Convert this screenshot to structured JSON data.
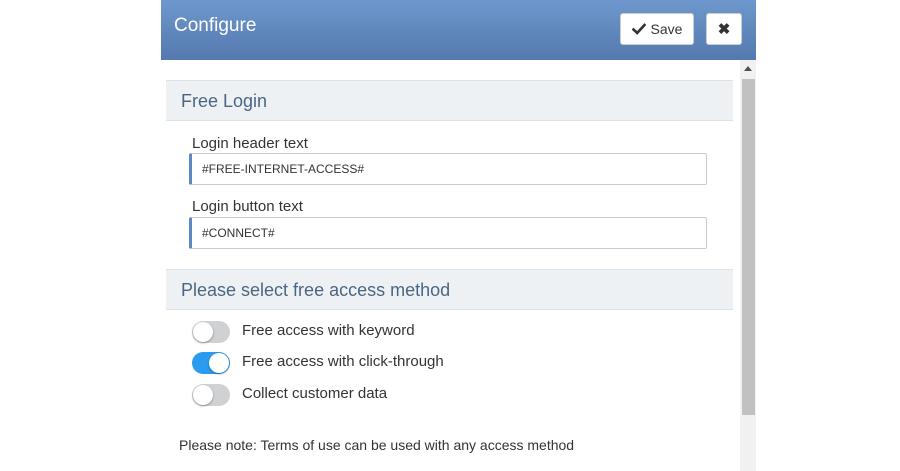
{
  "header": {
    "title": "Configure",
    "save_label": "Save",
    "save_icon": "check-icon",
    "close_icon": "close-icon",
    "close_glyph": "✖",
    "background_color": "#5f87bf"
  },
  "free_login": {
    "title": "Free Login",
    "header_text": {
      "label": "Login header text",
      "value": "#FREE-INTERNET-ACCESS#"
    },
    "button_text": {
      "label": "Login button text",
      "value": "#CONNECT#"
    }
  },
  "access_method": {
    "title": "Please select free access method",
    "options": [
      {
        "label": "Free access with keyword",
        "enabled": false
      },
      {
        "label": "Free access with click-through",
        "enabled": true
      },
      {
        "label": "Collect customer data",
        "enabled": false
      }
    ],
    "toggle_on_color": "#2b9bf0"
  },
  "note": "Please note: Terms of use can be used with any access method"
}
